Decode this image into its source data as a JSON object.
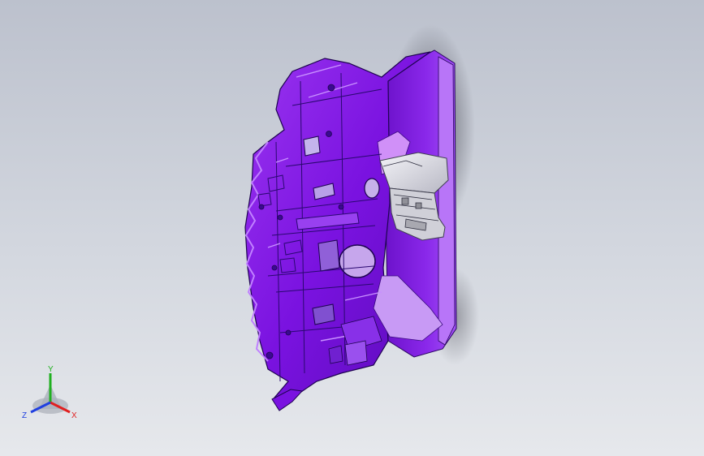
{
  "viewport": {
    "background_top": "#bcc1cd",
    "background_bottom": "#e6e8ec"
  },
  "model": {
    "part_color": "#7a12e0",
    "part_highlight": "#b05cf5",
    "part_shadow": "#4a0a9a",
    "insert_color": "#e2e2e8",
    "icon": "3d-part-icon"
  },
  "triad": {
    "x_label": "X",
    "y_label": "Y",
    "z_label": "Z",
    "x_color": "#e02020",
    "y_color": "#20b020",
    "z_color": "#2040e0"
  }
}
